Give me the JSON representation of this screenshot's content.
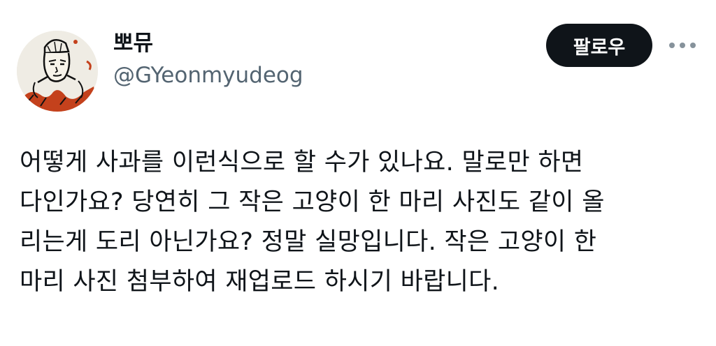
{
  "tweet": {
    "author": {
      "display_name": "뽀뮤",
      "handle": "@GYeonmyudeog",
      "avatar_icon": "illustrated-character-avatar"
    },
    "follow_label": "팔로우",
    "more_icon": "more-horizontal-icon",
    "text_lines": [
      "어떻게 사과를 이런식으로 할 수가 있나요. 말로만 하면",
      "다인가요? 당연히 그 작은 고양이 한 마리 사진도 같이 올",
      "리는게 도리 아닌가요? 정말 실망입니다. 작은 고양이 한",
      "마리 사진 첨부하여 재업로드 하시기 바랍니다."
    ]
  },
  "colors": {
    "text_primary": "#0f1419",
    "text_secondary": "#536471",
    "follow_bg": "#0f1419",
    "follow_text": "#ffffff",
    "avatar_bg": "#efece4",
    "avatar_accent": "#c4411c"
  }
}
